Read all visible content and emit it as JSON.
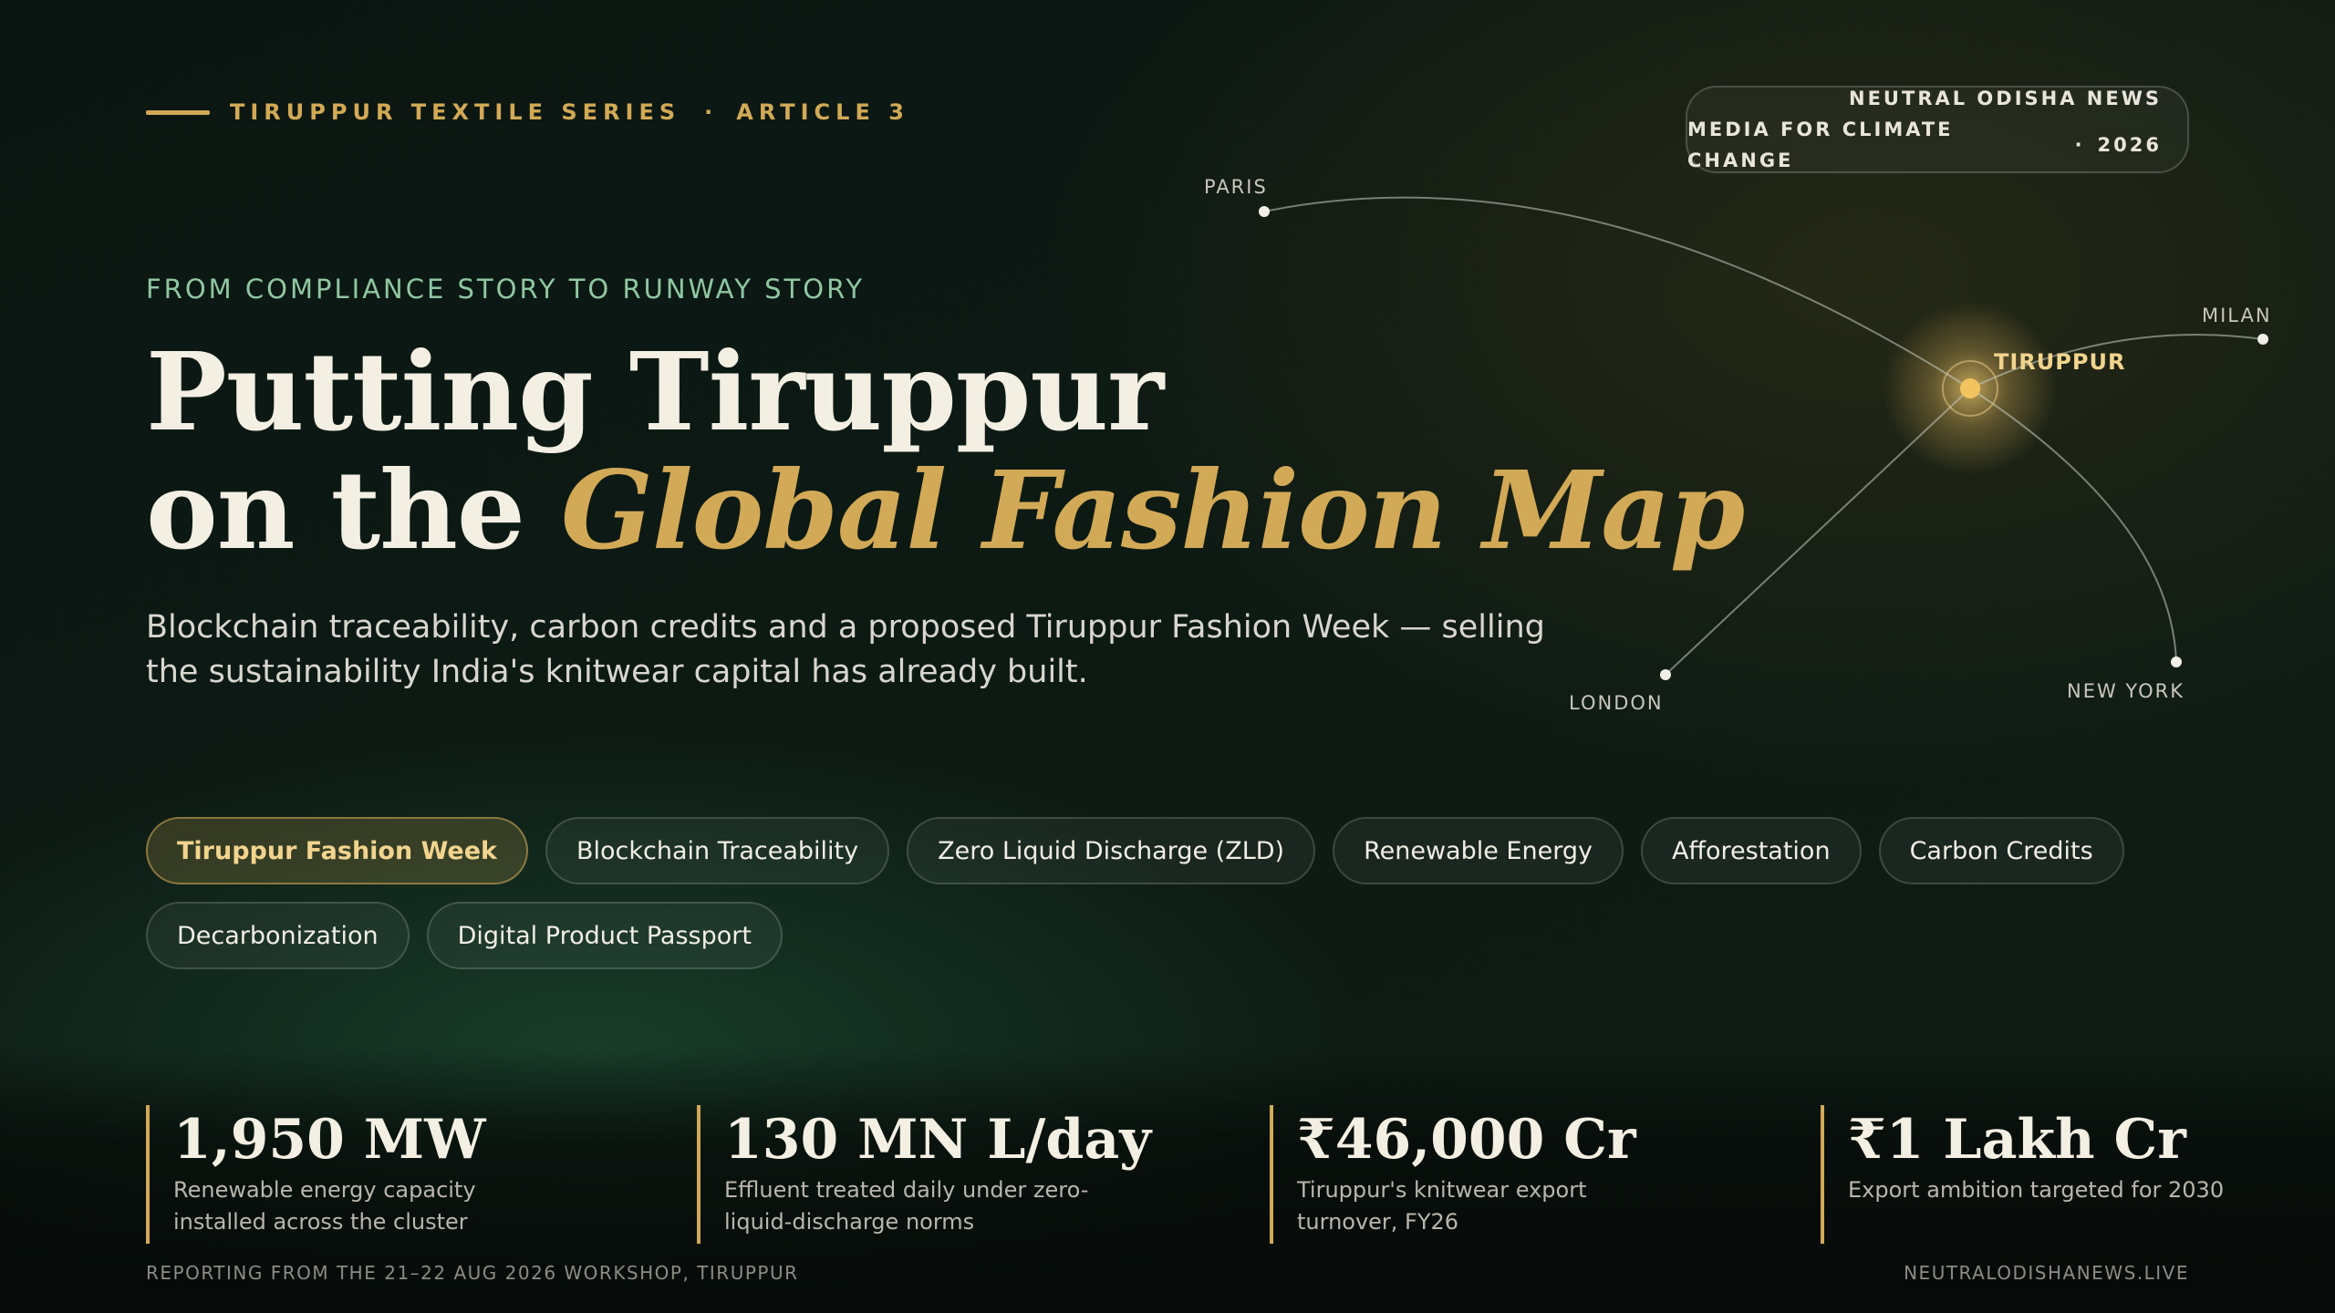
{
  "header": {
    "series": "TIRUPPUR TEXTILE SERIES",
    "separator": "·",
    "article": "ARTICLE 3"
  },
  "brand": {
    "name": "NEUTRAL ODISHA NEWS",
    "tagline": "MEDIA FOR CLIMATE CHANGE",
    "separator": "·",
    "year": "2026"
  },
  "eyebrow": "FROM COMPLIANCE STORY TO RUNWAY STORY",
  "headline": {
    "line1": "Putting Tiruppur",
    "line2_prefix": "on the ",
    "line2_accent": "Global Fashion Map"
  },
  "dek": "Blockchain traceability, carbon credits and a proposed Tiruppur Fashion Week — selling the sustainability India's knitwear capital has already built.",
  "map": {
    "hub": "TIRUPPUR",
    "cities": [
      "PARIS",
      "MILAN",
      "LONDON",
      "NEW YORK"
    ]
  },
  "tags": [
    {
      "label": "Tiruppur Fashion Week",
      "active": true
    },
    {
      "label": "Blockchain Traceability",
      "active": false
    },
    {
      "label": "Zero Liquid Discharge (ZLD)",
      "active": false
    },
    {
      "label": "Renewable Energy",
      "active": false
    },
    {
      "label": "Afforestation",
      "active": false
    },
    {
      "label": "Carbon Credits",
      "active": false
    },
    {
      "label": "Decarbonization",
      "active": false
    },
    {
      "label": "Digital Product Passport",
      "active": false
    }
  ],
  "stats": [
    {
      "value": "1,950 MW",
      "label": "Renewable energy capacity installed across the cluster"
    },
    {
      "value": "130 MN L/day",
      "label": "Effluent treated daily under zero-liquid-discharge norms"
    },
    {
      "value": "₹46,000 Cr",
      "label": "Tiruppur's knitwear export turnover, FY26"
    },
    {
      "value": "₹1 Lakh Cr",
      "label": "Export ambition targeted for 2030"
    }
  ],
  "footer": {
    "left": "REPORTING FROM THE 21–22 AUG 2026 WORKSHOP, TIRUPPUR",
    "right": "NEUTRALODISHANEWS.LIVE"
  },
  "colors": {
    "accent_gold": "#d2a956",
    "eyebrow_green": "#8fc7a1",
    "headline": "#f3efe3",
    "background": "#0d1a14"
  }
}
